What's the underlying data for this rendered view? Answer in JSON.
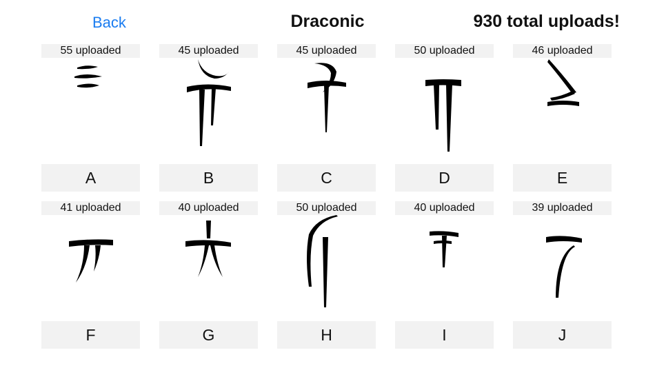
{
  "header": {
    "back_label": "Back",
    "title": "Draconic",
    "total_label": "930 total uploads!"
  },
  "cells": [
    {
      "letter": "A",
      "count_label": "55 uploaded"
    },
    {
      "letter": "B",
      "count_label": "45 uploaded"
    },
    {
      "letter": "C",
      "count_label": "45 uploaded"
    },
    {
      "letter": "D",
      "count_label": "50 uploaded"
    },
    {
      "letter": "E",
      "count_label": "46 uploaded"
    },
    {
      "letter": "F",
      "count_label": "41 uploaded"
    },
    {
      "letter": "G",
      "count_label": "40 uploaded"
    },
    {
      "letter": "H",
      "count_label": "50 uploaded"
    },
    {
      "letter": "I",
      "count_label": "40 uploaded"
    },
    {
      "letter": "J",
      "count_label": "39 uploaded"
    }
  ]
}
